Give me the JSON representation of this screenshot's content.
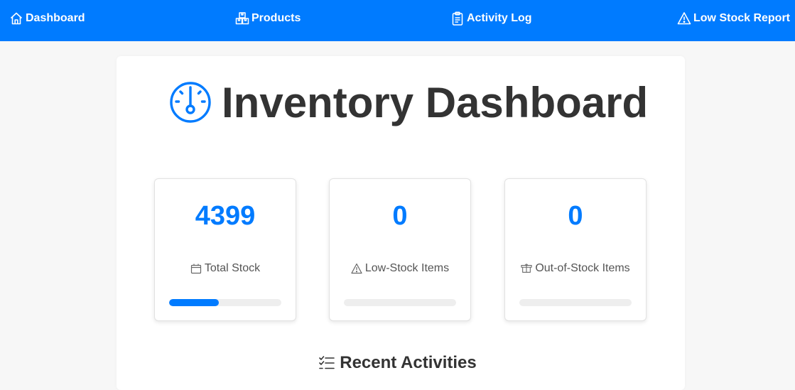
{
  "nav": {
    "items": [
      {
        "label": "Dashboard",
        "icon": "house-icon"
      },
      {
        "label": "Products",
        "icon": "boxes-icon"
      },
      {
        "label": "Activity Log",
        "icon": "clipboard-icon"
      },
      {
        "label": "Low Stock Report",
        "icon": "warning-triangle-icon"
      }
    ],
    "background": "#007bff"
  },
  "page": {
    "title": "Inventory Dashboard",
    "title_icon": "speedometer-icon",
    "accent": "#007bff"
  },
  "stats": [
    {
      "value": "4399",
      "label": "Total Stock",
      "icon": "box-icon",
      "progress": 0.44
    },
    {
      "value": "0",
      "label": "Low-Stock Items",
      "icon": "warning-triangle-icon",
      "progress": 0
    },
    {
      "value": "0",
      "label": "Out-of-Stock Items",
      "icon": "open-box-icon",
      "progress": 0
    }
  ],
  "recent": {
    "title": "Recent Activities",
    "icon": "list-check-icon"
  }
}
